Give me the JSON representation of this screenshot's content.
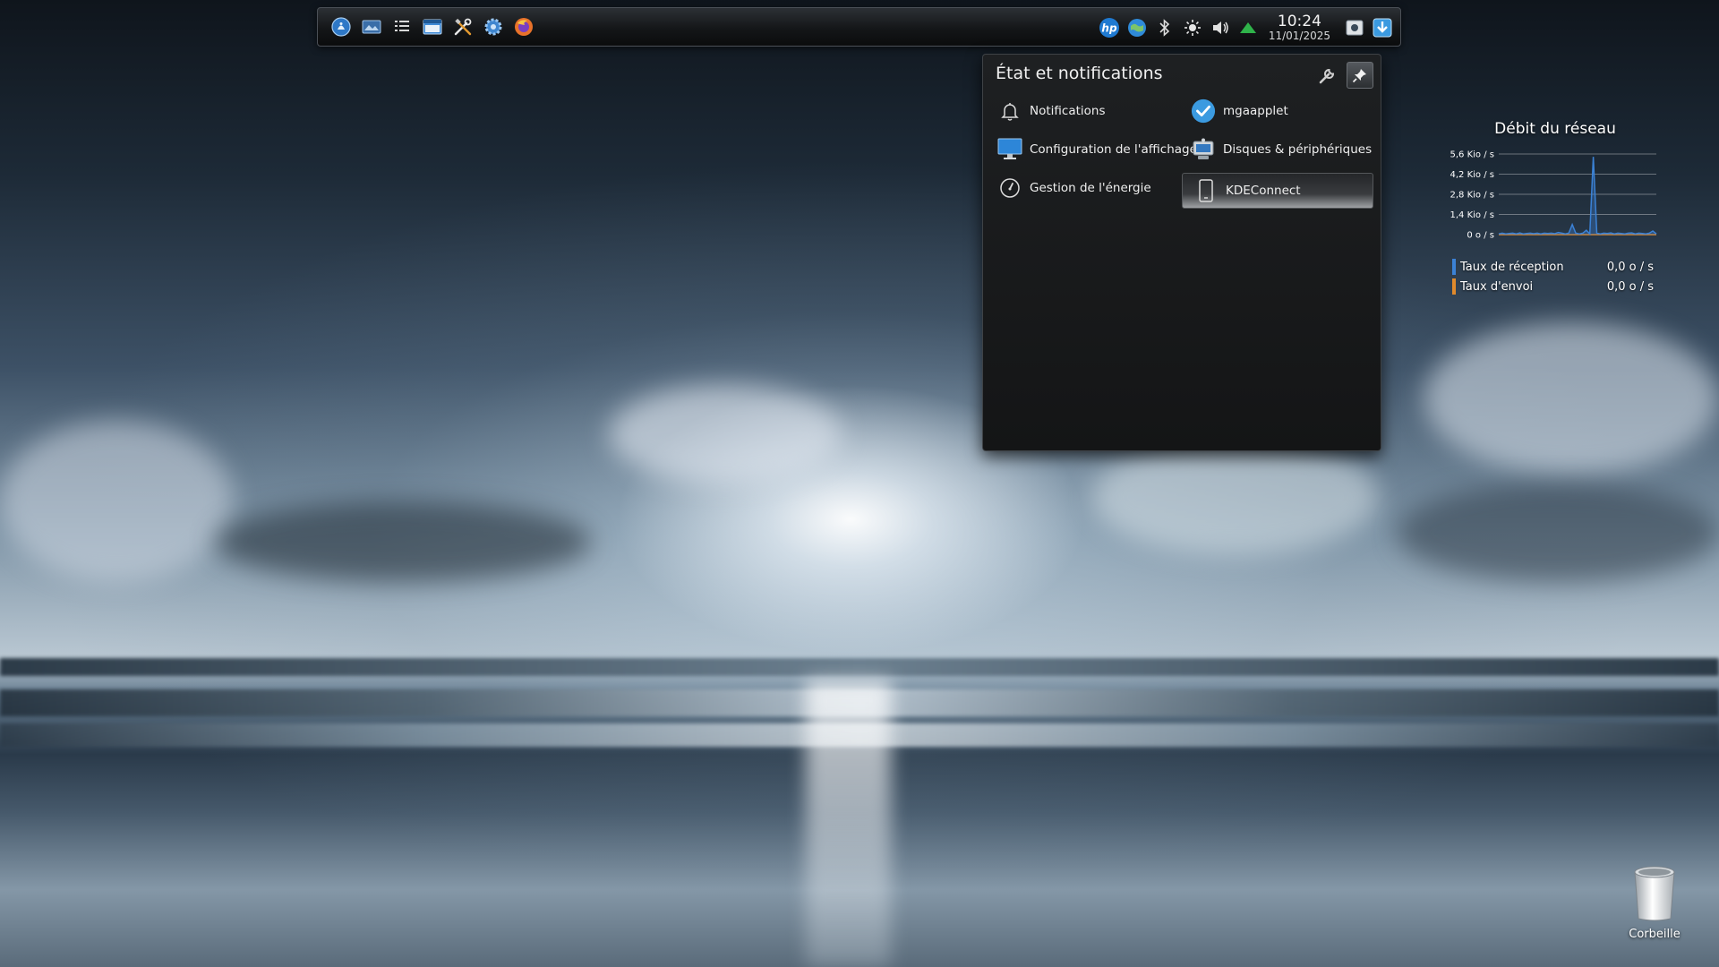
{
  "panel": {
    "launchers": [
      {
        "name": "mageia-menu",
        "icon": "mageia-menu-icon"
      },
      {
        "name": "show-desktop",
        "icon": "show-desktop-icon"
      },
      {
        "name": "task-list",
        "icon": "list-icon"
      },
      {
        "name": "file-manager",
        "icon": "window-icon"
      },
      {
        "name": "system-tools",
        "icon": "tools-icon"
      },
      {
        "name": "control-center",
        "icon": "gear-icon"
      },
      {
        "name": "firefox",
        "icon": "firefox-icon"
      }
    ],
    "tray": {
      "icons": [
        "hp-icon",
        "network-globe-icon",
        "bluetooth-icon",
        "brightness-icon",
        "volume-icon",
        "update-arrow-icon"
      ],
      "clock_time": "10:24",
      "clock_date": "11/01/2025"
    }
  },
  "popup": {
    "title": "État et notifications",
    "items": [
      {
        "label": "Notifications",
        "icon": "bell-icon"
      },
      {
        "label": "mgaapplet",
        "icon": "checkmark-icon"
      },
      {
        "label": "Configuration de l'affichage",
        "icon": "monitor-icon"
      },
      {
        "label": "Disques & périphériques",
        "icon": "drive-icon"
      },
      {
        "label": "Gestion de l'énergie",
        "icon": "power-gauge-icon"
      },
      {
        "label": "KDEConnect",
        "icon": "phone-icon"
      }
    ]
  },
  "network_widget": {
    "title": "Débit du réseau",
    "legend": [
      {
        "label": "Taux de réception",
        "value": "0,0 o / s",
        "color": "#3b82d6"
      },
      {
        "label": "Taux d'envoi",
        "value": "0,0 o / s",
        "color": "#e08a2c"
      }
    ]
  },
  "chart_data": {
    "type": "line",
    "title": "Débit du réseau",
    "ytick_labels": [
      "5,6 Kio / s",
      "4,2 Kio / s",
      "2,8 Kio / s",
      "1,4 Kio / s",
      "0 o / s"
    ],
    "ylim": [
      0,
      5.6
    ],
    "yunit": "Kio / s",
    "grid": true,
    "series": [
      {
        "name": "Taux de réception",
        "color": "#3b82d6",
        "values": [
          0.05,
          0.1,
          0.05,
          0.08,
          0.1,
          0.05,
          0.12,
          0.05,
          0.08,
          0.1,
          0.06,
          0.1,
          0.05,
          0.1,
          0.08,
          0.1,
          0.06,
          0.15,
          0.1,
          0.05,
          0.1,
          0.7,
          0.1,
          0.05,
          0.1,
          0.3,
          0.05,
          5.4,
          0.1,
          0.05,
          0.1,
          0.08,
          0.12,
          0.05,
          0.1,
          0.08,
          0.05,
          0.1,
          0.12,
          0.05,
          0.1,
          0.08,
          0.05,
          0.1,
          0.25,
          0.05
        ]
      },
      {
        "name": "Taux d'envoi",
        "color": "#e08a2c",
        "values": [
          0,
          0,
          0,
          0,
          0,
          0,
          0,
          0,
          0,
          0,
          0,
          0,
          0,
          0,
          0,
          0,
          0,
          0,
          0,
          0,
          0,
          0,
          0,
          0,
          0,
          0,
          0,
          0,
          0,
          0,
          0,
          0,
          0,
          0,
          0,
          0,
          0,
          0,
          0,
          0,
          0,
          0,
          0,
          0,
          0,
          0
        ]
      }
    ]
  },
  "desktop": {
    "trash_label": "Corbeille"
  }
}
